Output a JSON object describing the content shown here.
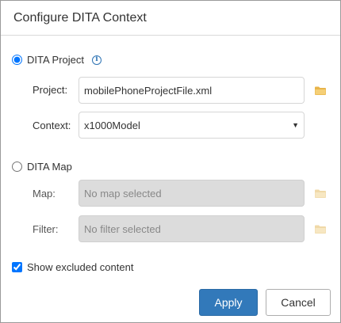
{
  "dialog": {
    "title": "Configure DITA Context"
  },
  "dita_project": {
    "label": "DITA Project",
    "selected": true,
    "info_icon": "info-icon",
    "project_label": "Project:",
    "project_value": "mobilePhoneProjectFile.xml",
    "context_label": "Context:",
    "context_value": "x1000Model",
    "browse_icon": "folder-icon"
  },
  "dita_map": {
    "label": "DITA Map",
    "selected": false,
    "map_label": "Map:",
    "map_placeholder": "No map selected",
    "filter_label": "Filter:",
    "filter_placeholder": "No filter selected",
    "browse_icon": "folder-icon"
  },
  "options": {
    "show_excluded_label": "Show excluded content",
    "show_excluded_checked": true
  },
  "buttons": {
    "apply": "Apply",
    "cancel": "Cancel"
  },
  "colors": {
    "accent": "#3279ba",
    "folder_active": "#e8b44a",
    "folder_disabled": "#f0d9a8",
    "disabled_field": "#dcdcdc"
  }
}
